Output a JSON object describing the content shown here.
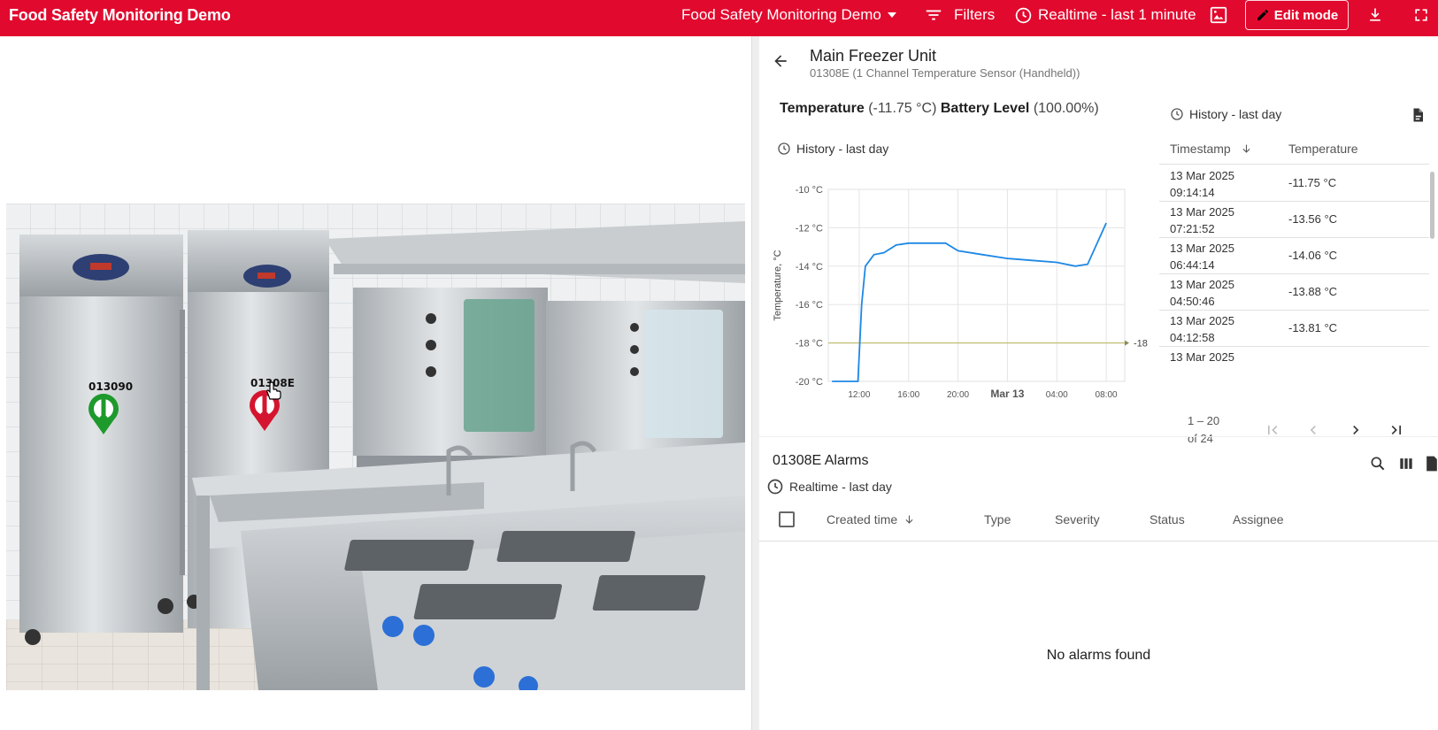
{
  "topbar": {
    "app_title": "Food Safety Monitoring Demo",
    "dashboard_select": "Food Safety Monitoring Demo",
    "filters_label": "Filters",
    "timewindow_label": "Realtime - last 1 minute",
    "edit_mode_label": "Edit mode",
    "bg_color": "#e2092e"
  },
  "scene": {
    "markers": [
      {
        "id": "013090",
        "status_color": "#1e9a2d"
      },
      {
        "id": "01308E",
        "status_color": "#d5152f"
      }
    ]
  },
  "device": {
    "name": "Main Freezer Unit",
    "subtitle": "01308E (1 Channel Temperature Sensor (Handheld))"
  },
  "chart_card": {
    "temp_label": "Temperature",
    "temp_value": "(-11.75 °C)",
    "battery_label": "Battery Level",
    "battery_value": "(100.00%)",
    "history_label": "History - last day"
  },
  "chart_data": {
    "type": "line",
    "ylabel": "Temperature, °C",
    "ylim": [
      -20,
      -10
    ],
    "y_ticks": [
      "-10 °C",
      "-12 °C",
      "-14 °C",
      "-16 °C",
      "-18 °C",
      "-20 °C"
    ],
    "x_ticks": [
      "12:00",
      "16:00",
      "20:00",
      "Mar 13",
      "04:00",
      "08:00"
    ],
    "threshold": {
      "value": -18,
      "label": "-18"
    },
    "series": [
      {
        "color": "#1e88e5",
        "x_hours": [
          9.8,
          11.9,
          12.2,
          12.5,
          13.2,
          14.0,
          15.0,
          16.0,
          17.0,
          18.0,
          19.0,
          20.0,
          22.0,
          24.0,
          26.0,
          28.0,
          29.5,
          30.5,
          32.0
        ],
        "values": [
          -20,
          -20,
          -16.0,
          -14.0,
          -13.4,
          -13.3,
          -12.9,
          -12.8,
          -12.8,
          -12.8,
          -12.8,
          -13.2,
          -13.4,
          -13.6,
          -13.7,
          -13.8,
          -14.0,
          -13.9,
          -11.75
        ]
      }
    ]
  },
  "history_table": {
    "history_label": "History - last day",
    "col_timestamp": "Timestamp",
    "col_temperature": "Temperature",
    "rows": [
      {
        "date": "13 Mar 2025",
        "time": "09:14:14",
        "value": "-11.75 °C"
      },
      {
        "date": "13 Mar 2025",
        "time": "07:21:52",
        "value": "-13.56 °C"
      },
      {
        "date": "13 Mar 2025",
        "time": "06:44:14",
        "value": "-14.06 °C"
      },
      {
        "date": "13 Mar 2025",
        "time": "04:50:46",
        "value": "-13.88 °C"
      },
      {
        "date": "13 Mar 2025",
        "time": "04:12:58",
        "value": "-13.81 °C"
      },
      {
        "date": "13 Mar 2025",
        "time": "",
        "value": ""
      }
    ],
    "range_label": "1 – 20",
    "of_label": "of 24"
  },
  "alarms": {
    "title": "01308E Alarms",
    "timewindow_label": "Realtime - last day",
    "columns": {
      "created": "Created time",
      "type": "Type",
      "severity": "Severity",
      "status": "Status",
      "assignee": "Assignee"
    },
    "empty_message": "No alarms found"
  }
}
